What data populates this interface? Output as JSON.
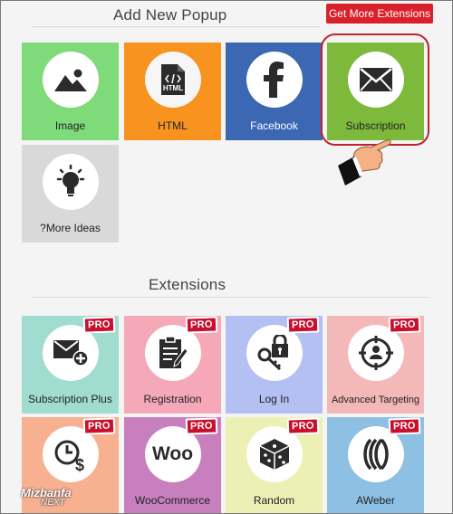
{
  "popup_section": {
    "title": "Add New Popup",
    "get_more_label": "Get More Extensions",
    "tiles": [
      {
        "label": "Image",
        "icon": "image-icon",
        "color": "#7fdb7a"
      },
      {
        "label": "HTML",
        "icon": "html-file-icon",
        "color": "#f7931e"
      },
      {
        "label": "Facebook",
        "icon": "facebook-icon",
        "color": "#3b67b3"
      },
      {
        "label": "Subscription",
        "icon": "envelope-icon",
        "color": "#7dba3c"
      },
      {
        "label": "?More Ideas",
        "icon": "lightbulb-icon",
        "color": "#d9d9d9"
      }
    ]
  },
  "extensions_section": {
    "title": "Extensions",
    "pro_label": "PRO",
    "tiles": [
      {
        "label": "Subscription Plus",
        "icon": "envelope-plus-icon",
        "color": "#a0dcd0"
      },
      {
        "label": "Registration",
        "icon": "clipboard-pen-icon",
        "color": "#f5a9b8"
      },
      {
        "label": "Log In",
        "icon": "lock-key-icon",
        "color": "#b4bff2"
      },
      {
        "label": "Advanced Targeting",
        "icon": "target-icon",
        "color": "#f5b8b8"
      },
      {
        "label": "",
        "icon": "clock-dollar-icon",
        "color": "#f7b090"
      },
      {
        "label": "WooCommerce",
        "icon": "woo-icon",
        "color": "#c77fbd"
      },
      {
        "label": "Random",
        "icon": "dice-icon",
        "color": "#ecf0b4"
      },
      {
        "label": "AWeber",
        "icon": "aweber-icon",
        "color": "#8ec0e4"
      }
    ]
  },
  "woo_text": "Woo",
  "watermark": {
    "line1": "Mizbanfa",
    "line2": "NEXT"
  }
}
